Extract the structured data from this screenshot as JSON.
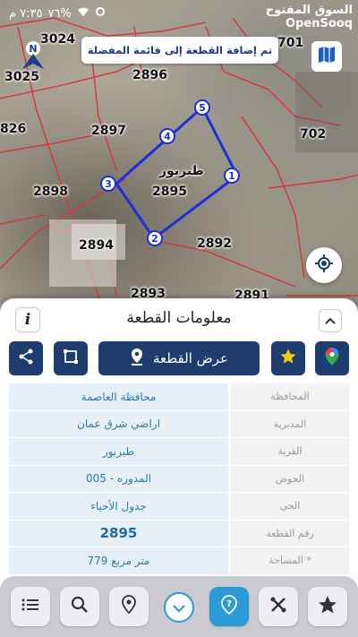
{
  "status_bar": {
    "time": "٧:٣٥ م",
    "battery": "٧٦%"
  },
  "brand": {
    "arabic": "السوق المفتوح",
    "latin": "OpenSooq"
  },
  "toast": {
    "message": "تم إضافة القطعة إلى قائمة المفضلة"
  },
  "map": {
    "north_label": "N",
    "parcel_labels": [
      "3024",
      "3025",
      "2896",
      "826",
      "2897",
      "2898",
      "2895",
      "2894",
      "2892",
      "2893",
      "702",
      "701",
      "2891"
    ],
    "selected_name": "طبربور",
    "vertices": [
      "1",
      "2",
      "3",
      "4",
      "5"
    ]
  },
  "sheet": {
    "title": "معلومات القطعة",
    "info_icon": "i",
    "show_parcel_label": "عرض القطعة",
    "rows": [
      {
        "label": "المحافظة",
        "value": "محافظة العاصمة"
      },
      {
        "label": "المديرية",
        "value": "اراضي شرق عمان"
      },
      {
        "label": "القرية",
        "value": "طبربور"
      },
      {
        "label": "الحوض",
        "value": "المدوره - 005"
      },
      {
        "label": "الحي",
        "value": "جدول الأحياء"
      },
      {
        "label": "رقم القطعة",
        "value": "2895"
      },
      {
        "label": "المساحة *",
        "value": "779  متر مربع"
      }
    ]
  },
  "colors": {
    "primary": "#1f3c6e",
    "accent": "#2a9bd7",
    "parcel_outline": "#1f2fd8",
    "value_text": "#2a7bb5"
  },
  "icons": [
    "north-arrow-icon",
    "map-layers-icon",
    "locate-icon",
    "info-icon",
    "chevron-up-icon",
    "share-icon",
    "crop-icon",
    "location-pin-icon",
    "star-icon",
    "google-maps-icon",
    "list-icon",
    "search-icon",
    "pin-icon",
    "chevron-down-icon",
    "help-icon",
    "tools-icon",
    "home-star-icon"
  ]
}
